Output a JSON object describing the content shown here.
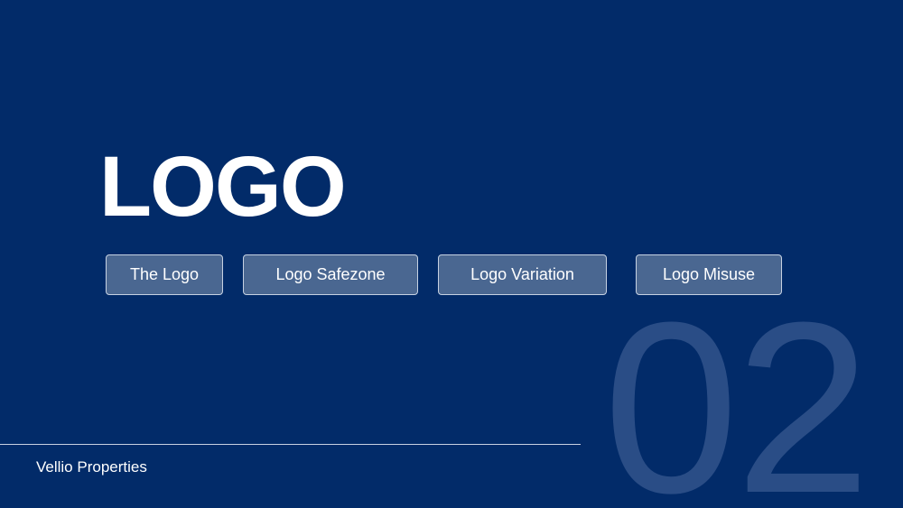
{
  "slide": {
    "title": "LOGO",
    "section_number": "02",
    "nav_buttons": [
      {
        "label": "The Logo"
      },
      {
        "label": "Logo Safezone"
      },
      {
        "label": "Logo Variation"
      },
      {
        "label": "Logo Misuse"
      }
    ],
    "footer": {
      "brand": "Vellio Properties"
    }
  },
  "colors": {
    "background": "#022b69",
    "button_fill": "#4a6791",
    "button_border": "#c6d1e2",
    "section_number": "#2a4d86",
    "text": "#ffffff"
  }
}
